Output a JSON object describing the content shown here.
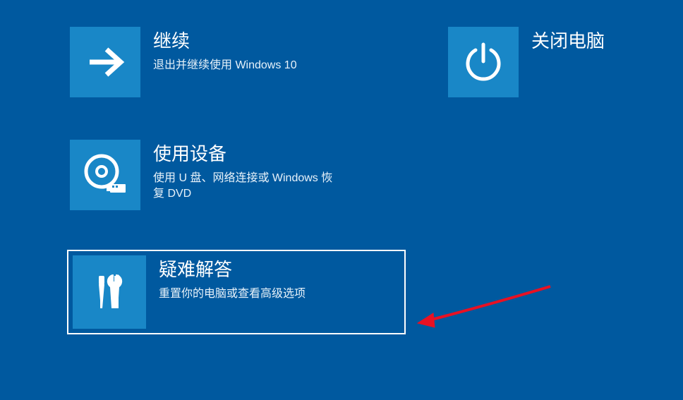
{
  "options": {
    "continue": {
      "title": "继续",
      "desc": "退出并继续使用 Windows 10"
    },
    "shutdown": {
      "title": "关闭电脑",
      "desc": ""
    },
    "use_device": {
      "title": "使用设备",
      "desc": "使用 U 盘、网络连接或 Windows 恢复 DVD"
    },
    "troubleshoot": {
      "title": "疑难解答",
      "desc": "重置你的电脑或查看高级选项"
    }
  }
}
